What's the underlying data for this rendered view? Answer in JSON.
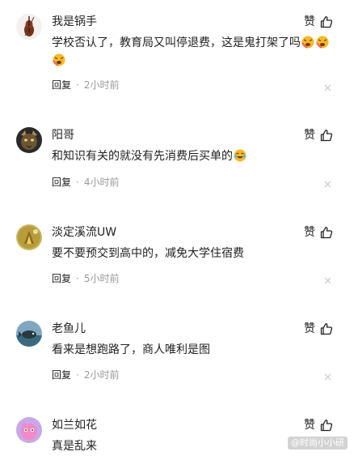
{
  "like_label": "赞",
  "reply_label": "回复",
  "dot": "·",
  "comments": [
    {
      "username": "我是锅手",
      "text": "学校否认了，教育局又叫停退费，这是鬼打架了吗",
      "emojis": [
        "fail-icon",
        "fail-icon",
        "fail-icon"
      ],
      "time": "2小时前"
    },
    {
      "username": "阳哥",
      "text": "和知识有关的就没有先消费后买单的",
      "emojis": [
        "laugh-cry-icon"
      ],
      "time": "4小时前"
    },
    {
      "username": "淡定溪流UW",
      "text": "要不要预交到高中的，减免大学住宿费",
      "time": "5小时前"
    },
    {
      "username": "老鱼儿",
      "text": "看来是想跑路了，商人唯利是图",
      "time": "2小时前"
    },
    {
      "username": "如兰如花",
      "text": "真是乱来"
    }
  ],
  "watermark": "@时尚小小研"
}
